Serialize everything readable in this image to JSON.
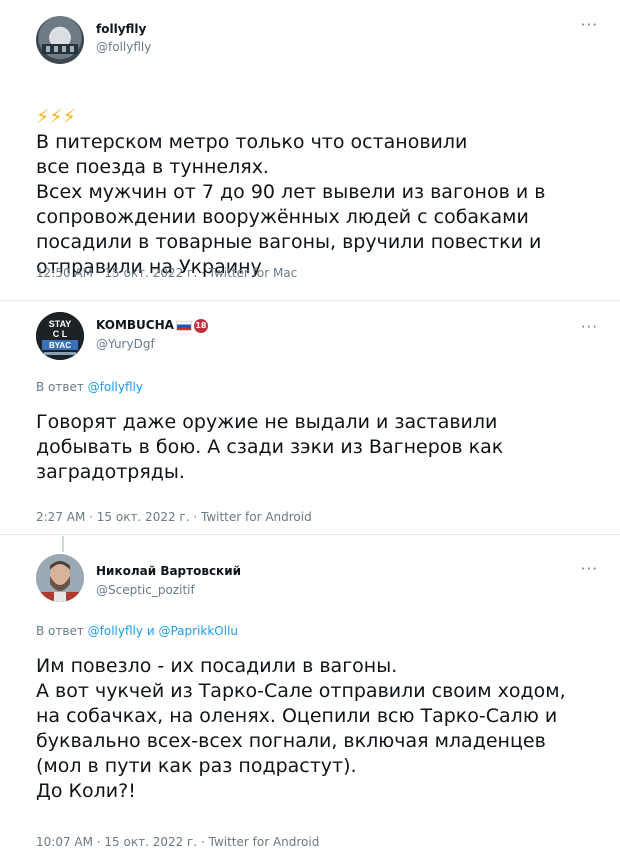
{
  "tweets": [
    {
      "name": "follyflly",
      "handle": "@follyflly",
      "emoji": "⚡⚡⚡",
      "text": "В питерском метро только что остановили\nвсе поезда в туннелях.\nВсех мужчин от 7 до 90 лет вывели из вагонов и в\nсопровождении вооружённых людей с собаками\nпосадили в товарные вагоны, вручили повестки и\nотправили на Украину",
      "meta": "12:50 AM · 15 окт. 2022 г. · Twitter for Mac"
    },
    {
      "name": "KOMBUCHA",
      "badge": "18",
      "handle": "@YuryDgf",
      "reply_prefix": "В ответ",
      "reply_to": "@follyflly",
      "text": "Говорят даже оружие не выдали и заставили\nдобывать в бою. А сзади зэки из Вагнеров как\nзаградотряды.",
      "meta": "2:27 AM · 15 окт. 2022 г. · Twitter for Android"
    },
    {
      "name": "Николай Вартовский",
      "handle": "@Sceptic_pozitif",
      "reply_prefix": "В ответ",
      "reply_to": "@follyflly",
      "reply_and": "и",
      "reply_to_2": "@PaprikkOllu",
      "text": "Им повезло - их посадили в вагоны.\nА вот чукчей из Тарко-Сале отправили своим ходом,\nна собачках, на оленях. Оцепили всю Тарко-Салю и\nбуквально всех-всех погнали, включая младенцев\n(мол в пути как раз подрастут).\nДо Коли?!",
      "meta": "10:07 AM · 15 окт. 2022 г. · Twitter for Android"
    }
  ],
  "more_icon": "more-dots-icon",
  "avatar_badge_text": [
    "STAY",
    "C  L",
    "BYAC"
  ],
  "colors": {
    "link": "#1d9bf0",
    "secondary": "#6b7a87",
    "text": "#0f1419",
    "bolt": "#f6b61b"
  }
}
